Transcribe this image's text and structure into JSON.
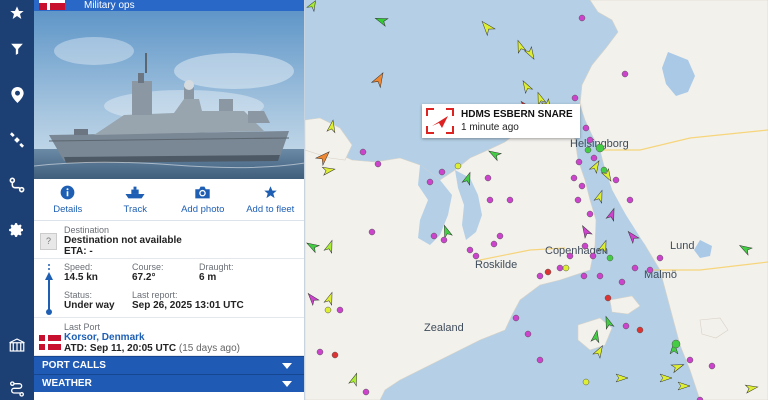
{
  "nav": {
    "items": [
      "star-icon",
      "filter-icon",
      "location-pin-icon",
      "satellite-icon",
      "route-icon",
      "settings-icon",
      "port-gate-icon",
      "route-planner-icon"
    ]
  },
  "panel": {
    "header_title": "Military ops",
    "actions": [
      {
        "label": "Details",
        "icon": "info-icon"
      },
      {
        "label": "Track",
        "icon": "ship-track-icon"
      },
      {
        "label": "Add photo",
        "icon": "camera-icon"
      },
      {
        "label": "Add to fleet",
        "icon": "star-icon"
      }
    ],
    "destination": {
      "label": "Destination",
      "value": "Destination not available",
      "eta_label": "ETA:",
      "eta_value": "-",
      "unknown_badge": "?"
    },
    "speed": {
      "label": "Speed:",
      "value": "14.5 kn"
    },
    "course": {
      "label": "Course:",
      "value": "67.2°"
    },
    "draught": {
      "label": "Draught:",
      "value": "6 m"
    },
    "status": {
      "label": "Status:",
      "value": "Under way"
    },
    "last_report": {
      "label": "Last report:",
      "value": "Sep 26, 2025 13:01 UTC"
    },
    "last_port": {
      "label": "Last Port",
      "name": "Korsor, Denmark",
      "atd_label": "ATD:",
      "atd_value": "Sep 11, 20:05 UTC",
      "atd_ago": "(15 days ago)"
    },
    "sections": [
      "PORT CALLS",
      "WEATHER"
    ]
  },
  "popup": {
    "vessel_name": "HDMS ESBERN SNARE",
    "time_ago": "1 minute ago"
  },
  "map": {
    "labels": [
      "Helsingborg",
      "Malmö",
      "Copenhagen",
      "Lund",
      "Roskilde",
      "Zealand"
    ],
    "colors": {
      "water": "#b5d0e6",
      "land": "#f3f1ec",
      "lake": "#a9c9e6"
    }
  },
  "colors": {
    "nav": "#1c3f74",
    "header": "#2a68c7",
    "accent": "#1e5fb4",
    "section": "#1f5ab5"
  }
}
